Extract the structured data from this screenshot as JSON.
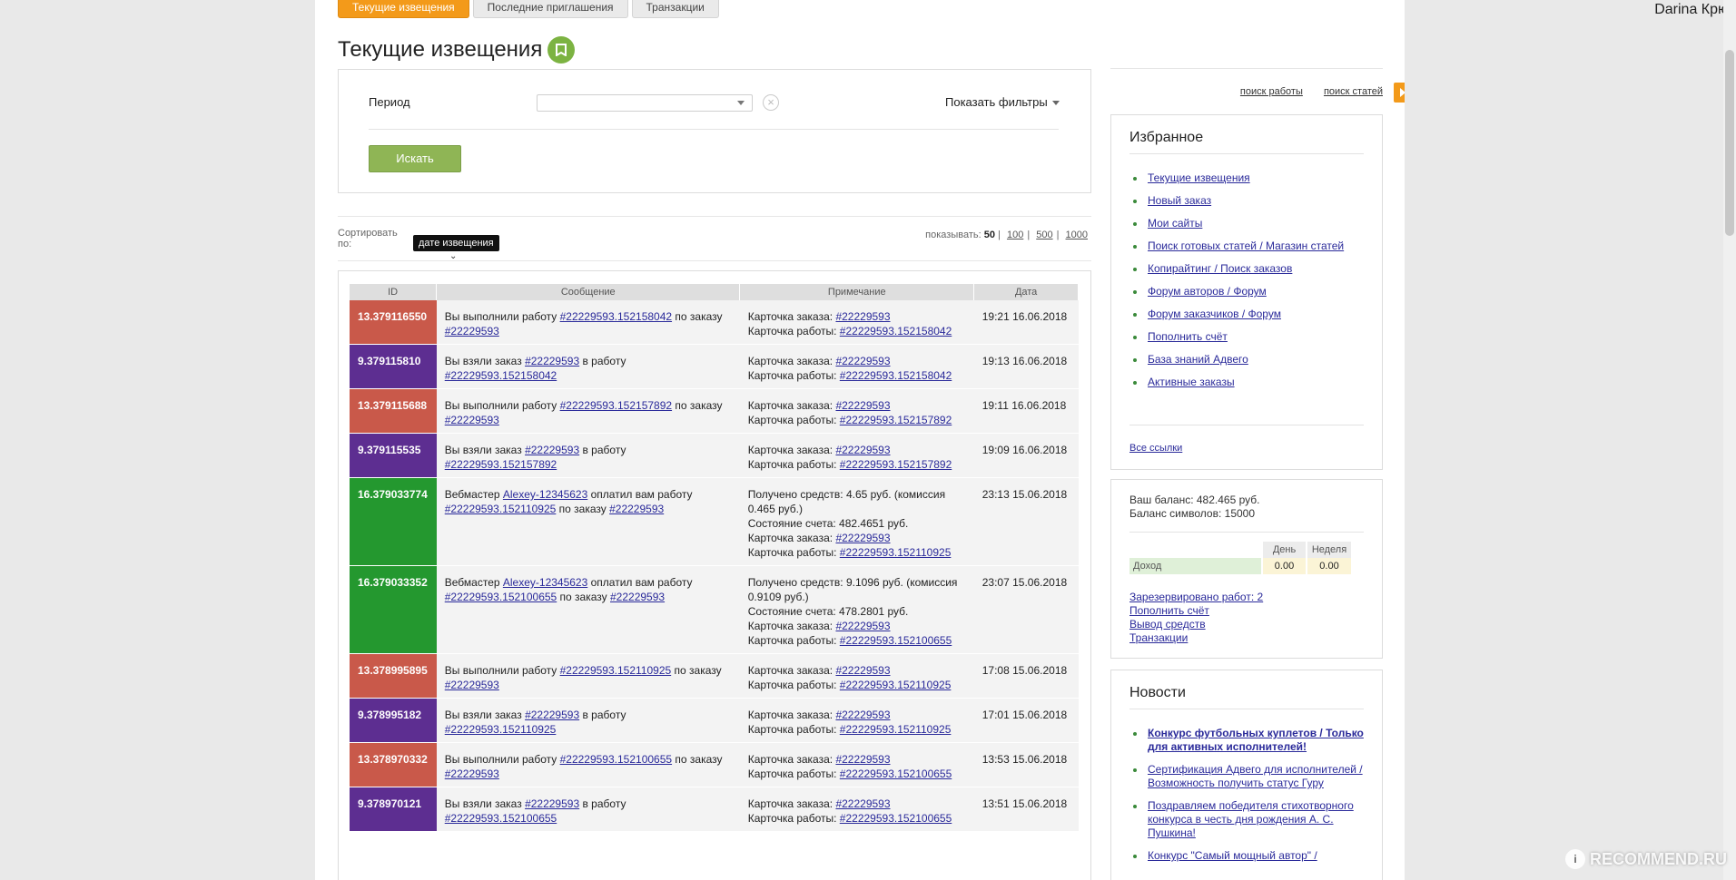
{
  "tabs": [
    "Текущие извещения",
    "Последние приглашения",
    "Транзакции"
  ],
  "page_title": "Текущие извещения",
  "filter": {
    "period_label": "Период",
    "period_value": "",
    "show_filters": "Показать фильтры",
    "search_button": "Искать"
  },
  "sort": {
    "label": "Сортировать по:",
    "value": "дате извещения",
    "show_label": "показывать:",
    "show_current": "50",
    "show_options": [
      "100",
      "500",
      "1000"
    ]
  },
  "table": {
    "headers": [
      "ID",
      "Сообщение",
      "Примечание",
      "Дата"
    ],
    "id_colors": {
      "red": "#c9594a",
      "purple": "#5d2e91",
      "green": "#24982f"
    },
    "rows": [
      {
        "id": "13.379116550",
        "color": "red",
        "msg": [
          [
            "t",
            "Вы выполнили работу "
          ],
          [
            "l",
            "#22229593.152158042"
          ],
          [
            "t",
            " по заказу "
          ],
          [
            "l",
            "#22229593"
          ]
        ],
        "note": [
          [
            [
              "t",
              "Карточка заказа: "
            ],
            [
              "l",
              "#22229593"
            ]
          ],
          [
            [
              "t",
              "Карточка работы: "
            ],
            [
              "l",
              "#22229593.152158042"
            ]
          ]
        ],
        "date": "19:21 16.06.2018"
      },
      {
        "id": "9.379115810",
        "color": "purple",
        "msg": [
          [
            "t",
            "Вы взяли заказ "
          ],
          [
            "l",
            "#22229593"
          ],
          [
            "t",
            " в работу "
          ],
          [
            "l",
            "#22229593.152158042"
          ]
        ],
        "note": [
          [
            [
              "t",
              "Карточка заказа: "
            ],
            [
              "l",
              "#22229593"
            ]
          ],
          [
            [
              "t",
              "Карточка работы: "
            ],
            [
              "l",
              "#22229593.152158042"
            ]
          ]
        ],
        "date": "19:13 16.06.2018"
      },
      {
        "id": "13.379115688",
        "color": "red",
        "msg": [
          [
            "t",
            "Вы выполнили работу "
          ],
          [
            "l",
            "#22229593.152157892"
          ],
          [
            "t",
            " по заказу "
          ],
          [
            "l",
            "#22229593"
          ]
        ],
        "note": [
          [
            [
              "t",
              "Карточка заказа: "
            ],
            [
              "l",
              "#22229593"
            ]
          ],
          [
            [
              "t",
              "Карточка работы: "
            ],
            [
              "l",
              "#22229593.152157892"
            ]
          ]
        ],
        "date": "19:11 16.06.2018"
      },
      {
        "id": "9.379115535",
        "color": "purple",
        "msg": [
          [
            "t",
            "Вы взяли заказ "
          ],
          [
            "l",
            "#22229593"
          ],
          [
            "t",
            " в работу "
          ],
          [
            "l",
            "#22229593.152157892"
          ]
        ],
        "note": [
          [
            [
              "t",
              "Карточка заказа: "
            ],
            [
              "l",
              "#22229593"
            ]
          ],
          [
            [
              "t",
              "Карточка работы: "
            ],
            [
              "l",
              "#22229593.152157892"
            ]
          ]
        ],
        "date": "19:09 16.06.2018"
      },
      {
        "id": "16.379033774",
        "color": "green",
        "msg": [
          [
            "t",
            "Вебмастер "
          ],
          [
            "l",
            "Alexey-12345623"
          ],
          [
            "t",
            " оплатил вам работу "
          ],
          [
            "l",
            "#22229593.152110925"
          ],
          [
            "t",
            " по заказу "
          ],
          [
            "l",
            "#22229593"
          ]
        ],
        "note": [
          [
            [
              "t",
              "Получено средств: 4.65 руб. (комиссия 0.465 руб.)"
            ]
          ],
          [
            [
              "t",
              "Состояние счета: 482.4651 руб."
            ]
          ],
          [
            [
              "t",
              "Карточка заказа: "
            ],
            [
              "l",
              "#22229593"
            ]
          ],
          [
            [
              "t",
              "Карточка работы: "
            ],
            [
              "l",
              "#22229593.152110925"
            ]
          ]
        ],
        "date": "23:13 15.06.2018"
      },
      {
        "id": "16.379033352",
        "color": "green",
        "msg": [
          [
            "t",
            "Вебмастер "
          ],
          [
            "l",
            "Alexey-12345623"
          ],
          [
            "t",
            " оплатил вам работу "
          ],
          [
            "l",
            "#22229593.152100655"
          ],
          [
            "t",
            " по заказу "
          ],
          [
            "l",
            "#22229593"
          ]
        ],
        "note": [
          [
            [
              "t",
              "Получено средств: 9.1096 руб. (комиссия 0.9109 руб.)"
            ]
          ],
          [
            [
              "t",
              "Состояние счета: 478.2801 руб."
            ]
          ],
          [
            [
              "t",
              "Карточка заказа: "
            ],
            [
              "l",
              "#22229593"
            ]
          ],
          [
            [
              "t",
              "Карточка работы: "
            ],
            [
              "l",
              "#22229593.152100655"
            ]
          ]
        ],
        "date": "23:07 15.06.2018"
      },
      {
        "id": "13.378995895",
        "color": "red",
        "msg": [
          [
            "t",
            "Вы выполнили работу "
          ],
          [
            "l",
            "#22229593.152110925"
          ],
          [
            "t",
            " по заказу "
          ],
          [
            "l",
            "#22229593"
          ]
        ],
        "note": [
          [
            [
              "t",
              "Карточка заказа: "
            ],
            [
              "l",
              "#22229593"
            ]
          ],
          [
            [
              "t",
              "Карточка работы: "
            ],
            [
              "l",
              "#22229593.152110925"
            ]
          ]
        ],
        "date": "17:08 15.06.2018"
      },
      {
        "id": "9.378995182",
        "color": "purple",
        "msg": [
          [
            "t",
            "Вы взяли заказ "
          ],
          [
            "l",
            "#22229593"
          ],
          [
            "t",
            " в работу "
          ],
          [
            "l",
            "#22229593.152110925"
          ]
        ],
        "note": [
          [
            [
              "t",
              "Карточка заказа: "
            ],
            [
              "l",
              "#22229593"
            ]
          ],
          [
            [
              "t",
              "Карточка работы: "
            ],
            [
              "l",
              "#22229593.152110925"
            ]
          ]
        ],
        "date": "17:01 15.06.2018"
      },
      {
        "id": "13.378970332",
        "color": "red",
        "msg": [
          [
            "t",
            "Вы выполнили работу "
          ],
          [
            "l",
            "#22229593.152100655"
          ],
          [
            "t",
            " по заказу "
          ],
          [
            "l",
            "#22229593"
          ]
        ],
        "note": [
          [
            [
              "t",
              "Карточка заказа: "
            ],
            [
              "l",
              "#22229593"
            ]
          ],
          [
            [
              "t",
              "Карточка работы: "
            ],
            [
              "l",
              "#22229593.152100655"
            ]
          ]
        ],
        "date": "13:53 15.06.2018"
      },
      {
        "id": "9.378970121",
        "color": "purple",
        "msg": [
          [
            "t",
            "Вы взяли заказ "
          ],
          [
            "l",
            "#22229593"
          ],
          [
            "t",
            " в работу "
          ],
          [
            "l",
            "#22229593.152100655"
          ]
        ],
        "note": [
          [
            [
              "t",
              "Карточка заказа: "
            ],
            [
              "l",
              "#22229593"
            ]
          ],
          [
            [
              "t",
              "Карточка работы: "
            ],
            [
              "l",
              "#22229593.152100655"
            ]
          ]
        ],
        "date": "13:51 15.06.2018"
      }
    ]
  },
  "sidebar": {
    "quick_links": [
      "поиск работы",
      "поиск статей"
    ],
    "favorites": {
      "title": "Избранное",
      "items": [
        "Текущие извещения",
        "Новый заказ",
        "Мои сайты",
        "Поиск готовых статей / Магазин статей",
        "Копирайтинг / Поиск заказов",
        "Форум авторов / Форум",
        "Форум заказчиков / Форум",
        "Пополнить счёт",
        "База знаний Адвего",
        "Активные заказы"
      ],
      "all_links": "Все ссылки"
    },
    "balance": {
      "balance_line": "Ваш баланс: 482.465 руб.",
      "chars_line": "Баланс символов: 15000",
      "col_day": "День",
      "col_week": "Неделя",
      "income_label": "Доход",
      "income_day": "0.00",
      "income_week": "0.00",
      "links": [
        "Зарезервировано работ: 2",
        "Пополнить счёт",
        "Вывод средств",
        "Транзакции"
      ]
    },
    "news": {
      "title": "Новости",
      "items": [
        {
          "text": "Конкурс футбольных куплетов / Только для активных исполнителей!",
          "bold": true
        },
        {
          "text": "Сертификация Адвего для исполнителей / Возможность получить статус Гуру",
          "bold": false
        },
        {
          "text": "Поздравляем победителя стихотворного конкурса в честь дня рождения А. С. Пушкина!",
          "bold": false
        },
        {
          "text": "Конкурс \"Самый мощный автор\" /",
          "bold": false
        }
      ]
    }
  },
  "user_name": "Darina Крю",
  "watermark": "RECOMMEND.RU",
  "accent_color": "#f39a1a"
}
